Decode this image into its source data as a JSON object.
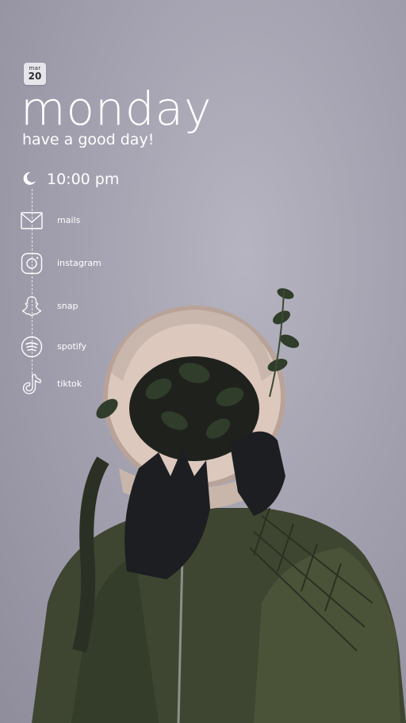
{
  "date": {
    "month": "mar",
    "day": "20"
  },
  "weekday": "monday",
  "greeting": "have a good day!",
  "time": "10:00 pm",
  "apps": [
    {
      "label": "mails",
      "icon": "mail-icon"
    },
    {
      "label": "instagram",
      "icon": "instagram-icon"
    },
    {
      "label": "snap",
      "icon": "snapchat-icon"
    },
    {
      "label": "spotify",
      "icon": "spotify-icon"
    },
    {
      "label": "tiktok",
      "icon": "tiktok-icon"
    }
  ],
  "colors": {
    "background": "#a4a2b0",
    "text": "#ffffff",
    "badge": "#e6e5ea"
  }
}
